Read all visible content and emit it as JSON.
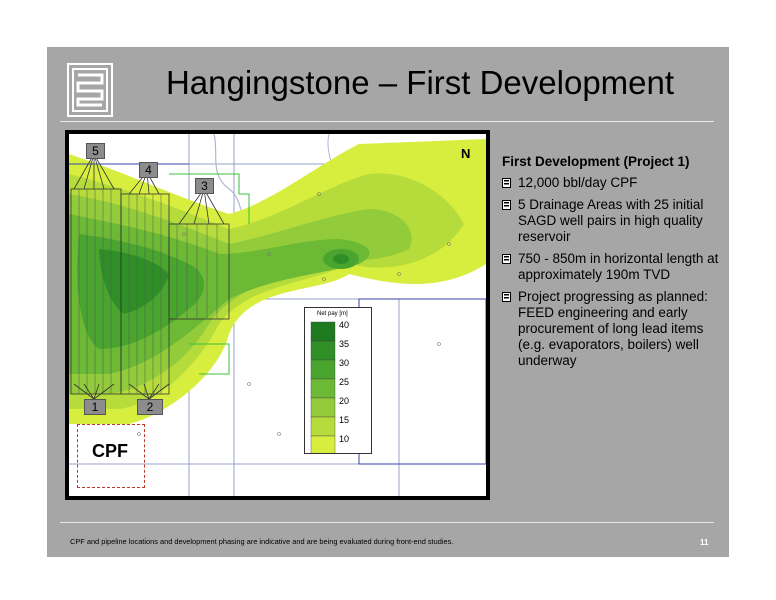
{
  "slide": {
    "title": "Hangingstone – First Development",
    "footer_note": "CPF and pipeline locations and development phasing are indicative and are being evaluated during front-end studies.",
    "page_number": "11"
  },
  "map": {
    "north_label": "N",
    "cpf_label": "CPF",
    "drainage_labels": [
      "1",
      "2",
      "3",
      "4",
      "5"
    ],
    "legend": {
      "title": "Net pay [m]",
      "values": [
        "40",
        "35",
        "30",
        "25",
        "20",
        "15",
        "10"
      ],
      "colors": [
        "#1e7a1e",
        "#2f8f26",
        "#4aa52e",
        "#6cb935",
        "#93cc3a",
        "#b6dc3c",
        "#d8ee3e"
      ]
    }
  },
  "content": {
    "heading": "First Development (Project 1)",
    "bullets": [
      "12,000 bbl/day CPF",
      "5 Drainage Areas with 25 initial SAGD well pairs in high quality reservoir",
      "750 - 850m in horizontal length at approximately 190m TVD",
      "Project progressing as planned: FEED engineering and early procurement of long lead items (e.g. evaporators, boilers) well underway"
    ]
  }
}
